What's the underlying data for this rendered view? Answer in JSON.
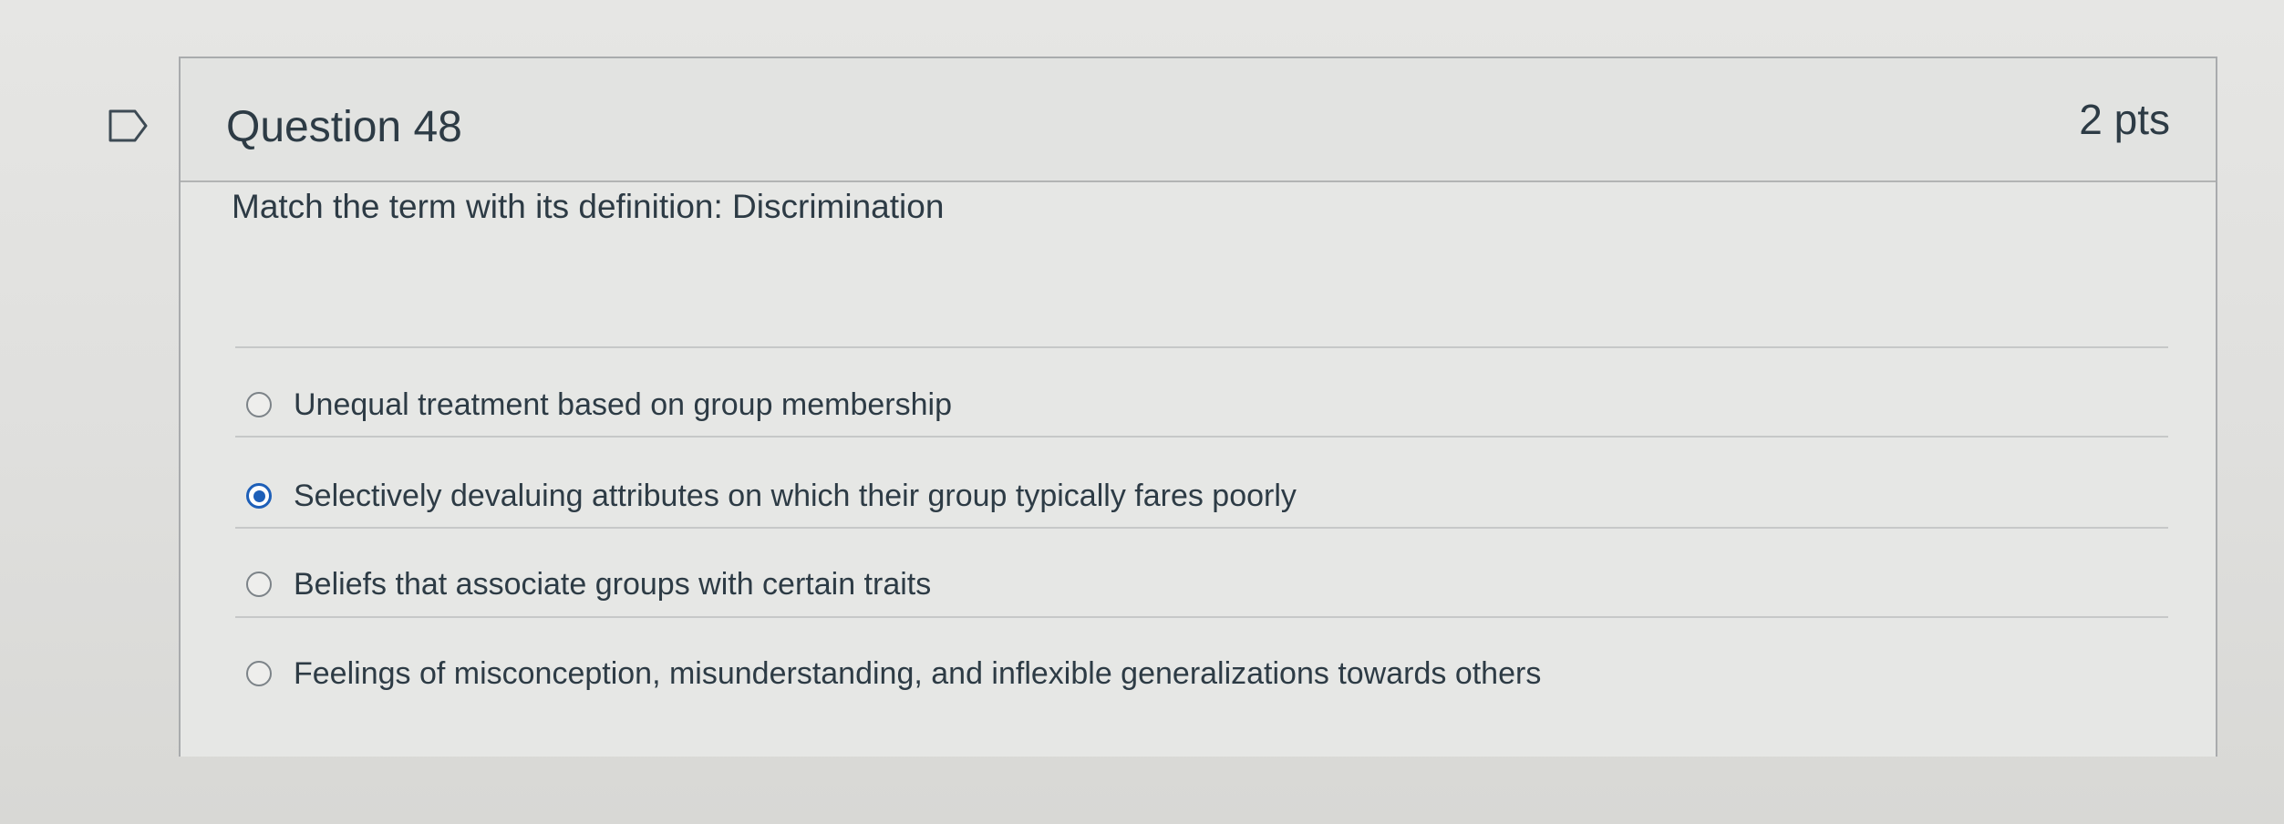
{
  "question": {
    "title": "Question 48",
    "points": "2 pts",
    "text": "Match the term with its definition: Discrimination"
  },
  "answers": [
    {
      "label": "Unequal treatment based on group membership",
      "selected": false
    },
    {
      "label": "Selectively devaluing attributes on which their group typically fares poorly",
      "selected": true
    },
    {
      "label": "Beliefs that associate groups with certain traits",
      "selected": false
    },
    {
      "label": "Feelings of misconception, misunderstanding, and inflexible generalizations towards others",
      "selected": false
    }
  ],
  "icons": {
    "flag": "flag-question-icon",
    "radio_empty": "radio-unselected-icon",
    "radio_selected": "radio-selected-icon"
  },
  "colors": {
    "accent": "#1d5fb8",
    "text": "#2d3b45",
    "border": "#a9abad"
  }
}
